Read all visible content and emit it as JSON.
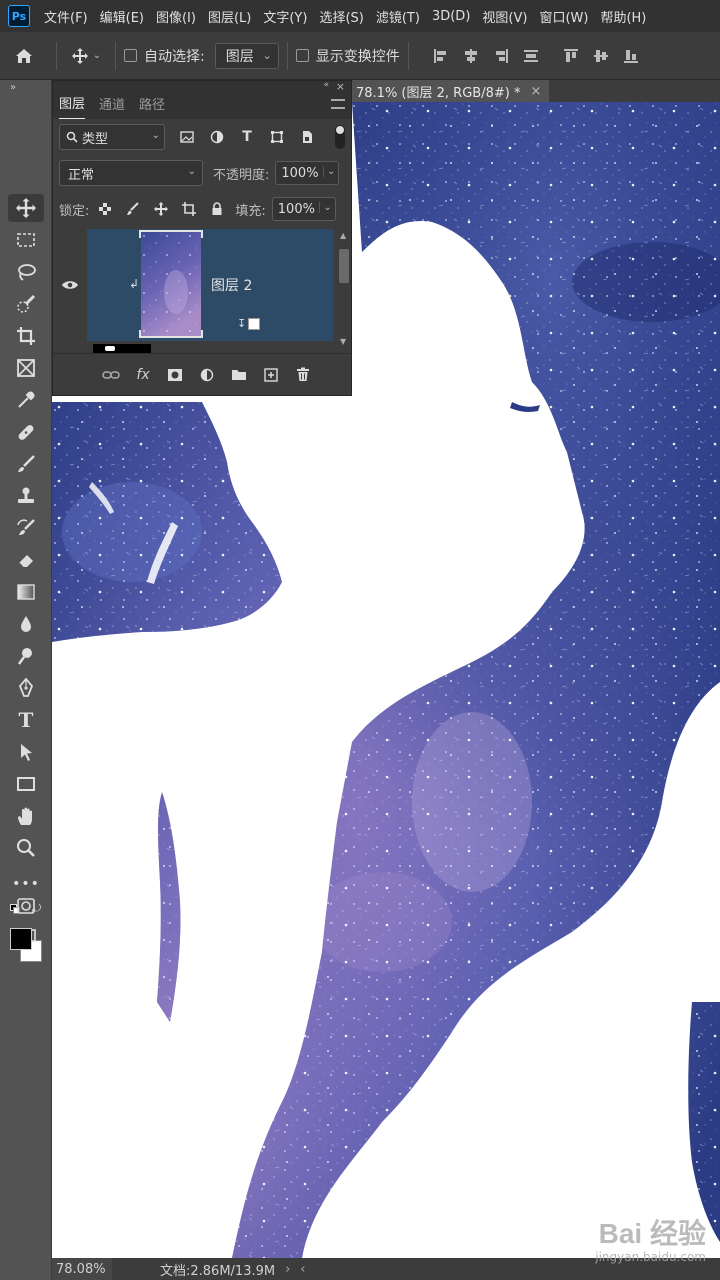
{
  "app": {
    "logo_text": "Ps"
  },
  "menu": {
    "items": [
      {
        "label": "文件(F)"
      },
      {
        "label": "编辑(E)"
      },
      {
        "label": "图像(I)"
      },
      {
        "label": "图层(L)"
      },
      {
        "label": "文字(Y)"
      },
      {
        "label": "选择(S)"
      },
      {
        "label": "滤镜(T)"
      },
      {
        "label": "3D(D)"
      },
      {
        "label": "视图(V)"
      },
      {
        "label": "窗口(W)"
      },
      {
        "label": "帮助(H)"
      }
    ]
  },
  "options_bar": {
    "auto_select_label": "自动选择:",
    "auto_select_checked": false,
    "auto_select_target": "图层",
    "show_transform_label": "显示变换控件",
    "show_transform_checked": false
  },
  "document": {
    "tab_title": "78.1% (图层 2, RGB/8#) *",
    "close_glyph": "×"
  },
  "layers_panel": {
    "tabs": [
      {
        "label": "图层",
        "active": true
      },
      {
        "label": "通道",
        "active": false
      },
      {
        "label": "路径",
        "active": false
      }
    ],
    "filter_kind": "类型",
    "blend_mode": "正常",
    "opacity_label": "不透明度:",
    "opacity_value": "100%",
    "lock_label": "锁定:",
    "fill_label": "填充:",
    "fill_value": "100%",
    "layers": [
      {
        "name": "图层 2",
        "visible": true,
        "selected": true,
        "clipped": true
      }
    ],
    "bottom_icons": [
      "link-icon",
      "fx-icon",
      "mask-icon",
      "adjustment-icon",
      "folder-icon",
      "new-layer-icon",
      "trash-icon"
    ],
    "fx_glyph": "fx"
  },
  "toolbar": {
    "tools": [
      "move-tool",
      "marquee-tool",
      "lasso-tool",
      "quick-select-tool",
      "crop-tool",
      "frame-tool",
      "eyedropper-tool",
      "healing-tool",
      "brush-tool",
      "stamp-tool",
      "history-brush-tool",
      "eraser-tool",
      "gradient-tool",
      "blur-tool",
      "dodge-tool",
      "pen-tool",
      "type-tool",
      "path-select-tool",
      "rectangle-tool",
      "hand-tool",
      "zoom-tool",
      "more-tools"
    ],
    "type_glyph": "T",
    "more_glyph": "•••",
    "foreground_color": "#000000",
    "background_color": "#ffffff"
  },
  "status_bar": {
    "zoom": "78.08%",
    "doc_info": "文档:2.86M/13.9M"
  },
  "watermark": {
    "logo": "Bai 经验",
    "url": "jingyan.baidu.com"
  },
  "colors": {
    "accent": "#31a8ff",
    "panel_bg": "#3c3c3c",
    "menu_bg": "#323232",
    "selected_layer": "#2d4a66",
    "galaxy_deep": "#2b3c84",
    "galaxy_mid": "#4b57a8",
    "galaxy_violet": "#7a6cb8"
  }
}
